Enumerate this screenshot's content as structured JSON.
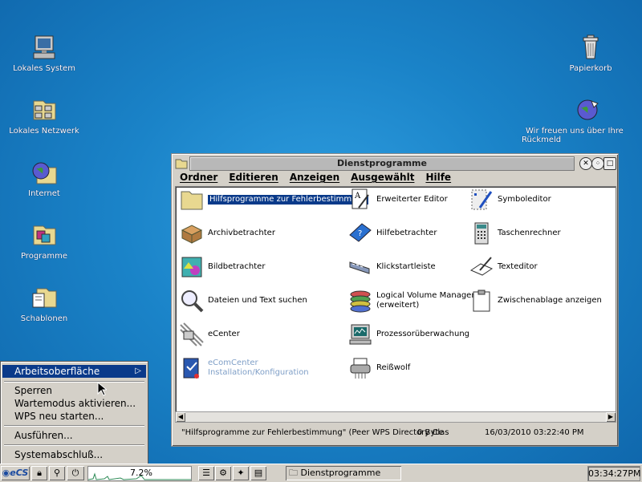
{
  "desktop": {
    "icons": [
      {
        "label": "Lokales System",
        "icon": "computer-icon"
      },
      {
        "label": "Lokales Netzwerk",
        "icon": "network-icon"
      },
      {
        "label": "Internet",
        "icon": "internet-globe-icon"
      },
      {
        "label": "Programme",
        "icon": "programs-folder-icon"
      },
      {
        "label": "Schablonen",
        "icon": "templates-folder-icon"
      },
      {
        "label": "Papierkorb",
        "icon": "trash-icon"
      },
      {
        "label": "Wir freuen uns über Ihre Rückmeld",
        "icon": "feedback-globe-icon"
      }
    ]
  },
  "window": {
    "title": "Dienstprogramme",
    "menu": [
      "Ordner",
      "Editieren",
      "Anzeigen",
      "Ausgewählt",
      "Hilfe"
    ],
    "items": [
      {
        "label": "Hilfsprogramme zur Fehlerbestimmung",
        "icon": "folder-icon"
      },
      {
        "label": "Archivbetrachter",
        "icon": "archive-box-icon"
      },
      {
        "label": "Bildbetrachter",
        "icon": "image-viewer-icon"
      },
      {
        "label": "Dateien und Text suchen",
        "icon": "magnifier-icon"
      },
      {
        "label": "eCenter",
        "icon": "ecenter-icon"
      },
      {
        "label": "eComCenter",
        "label2": "Installation/Konfiguration",
        "icon": "install-book-icon"
      },
      {
        "label": "Erweiterter Editor",
        "icon": "editor-icon"
      },
      {
        "label": "Hilfebetrachter",
        "icon": "help-book-icon"
      },
      {
        "label": "Klickstartleiste",
        "icon": "launchpad-icon"
      },
      {
        "label": "Logical Volume Manager",
        "label2": "(erweitert)",
        "icon": "lvm-disks-icon"
      },
      {
        "label": "Prozessorüberwachung",
        "icon": "cpu-monitor-icon"
      },
      {
        "label": "Reißwolf",
        "icon": "shredder-icon"
      },
      {
        "label": "Symboleditor",
        "icon": "icon-editor-icon"
      },
      {
        "label": "Taschenrechner",
        "icon": "calculator-icon"
      },
      {
        "label": "Texteditor",
        "icon": "text-editor-icon"
      },
      {
        "label": "Zwischenablage anzeigen",
        "icon": "clipboard-icon"
      }
    ],
    "status": {
      "object": "\"Hilfsprogramme zur Fehlerbestimmung\" (Peer WPS Directory Clas",
      "size": "0 Byte",
      "datetime": "16/03/2010 03:22:40 PM"
    }
  },
  "start_menu": {
    "items": [
      "Arbeitsoberfläche",
      "Sperren",
      "Wartemodus aktivieren...",
      "WPS neu starten...",
      "Ausführen...",
      "Systemabschluß..."
    ]
  },
  "taskbar": {
    "cpu_percent": "7.2%",
    "task_label": "Dienstprogramme",
    "clock": "03:34:27PM"
  },
  "colors": {
    "desktop": "#1a83c8",
    "selection": "#0a3a8a"
  }
}
